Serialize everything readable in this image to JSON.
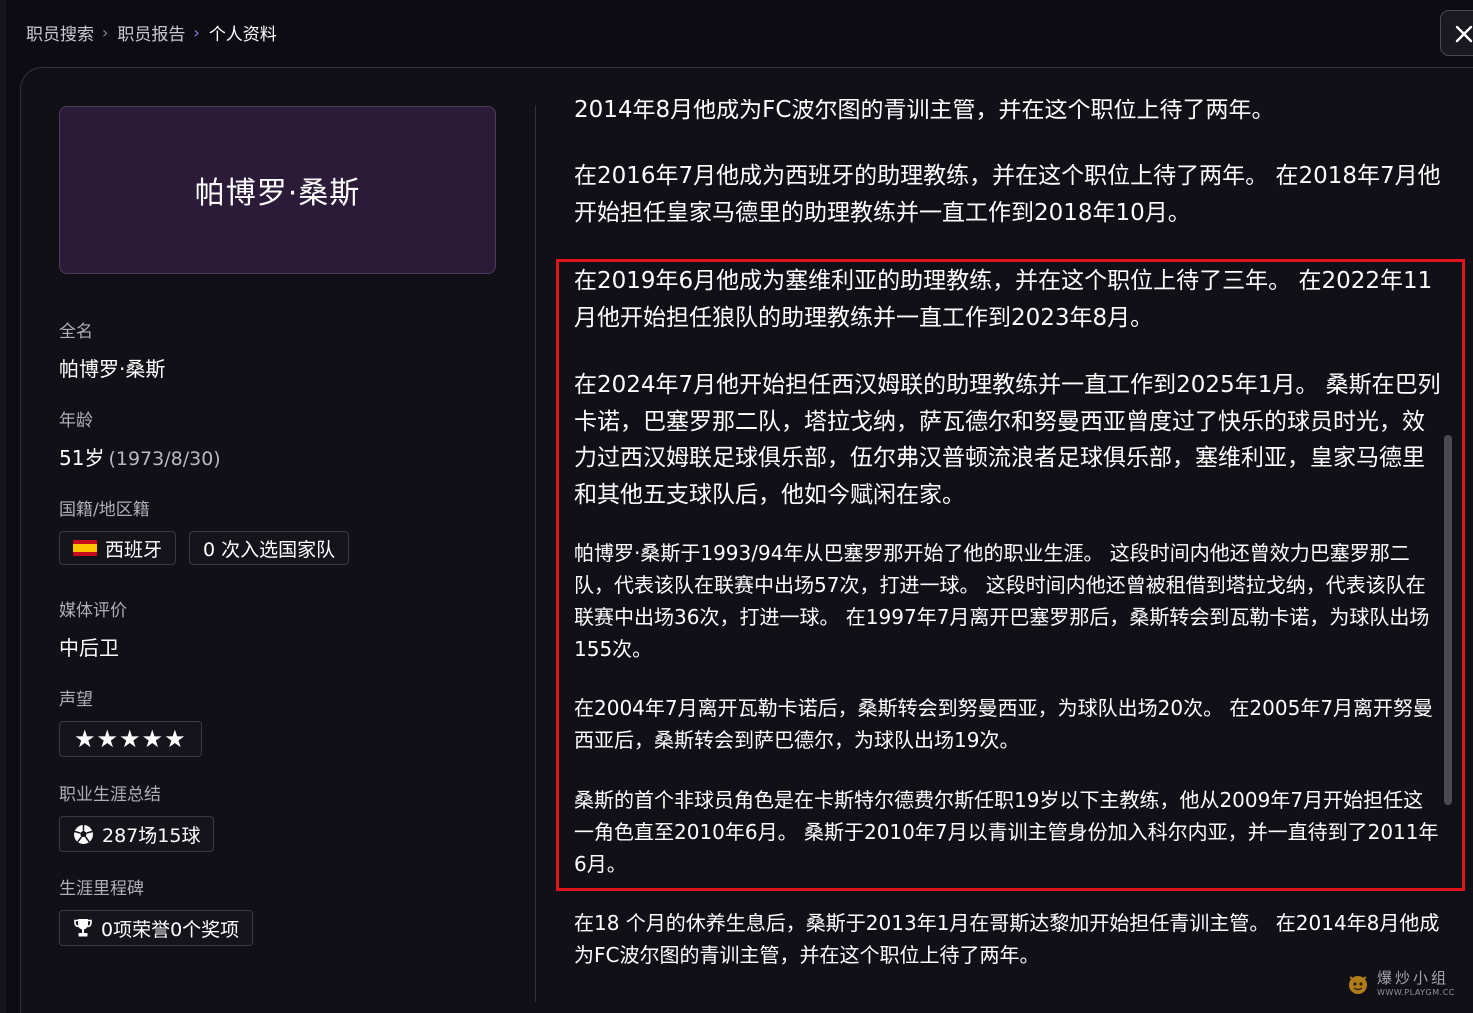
{
  "breadcrumb": {
    "items": [
      "职员搜索",
      "职员报告",
      "个人资料"
    ]
  },
  "close_button": {
    "icon": "close-icon"
  },
  "profile": {
    "card_name": "帕博罗·桑斯",
    "fields": {
      "full_name": {
        "label": "全名",
        "value": "帕博罗·桑斯"
      },
      "age": {
        "label": "年龄",
        "value": "51岁",
        "birth": "(1973/8/30)"
      },
      "nationality": {
        "label": "国籍/地区籍",
        "country": "西班牙",
        "caps": "0 次入选国家队"
      },
      "media_rating": {
        "label": "媒体评价",
        "value": "中后卫"
      },
      "reputation": {
        "label": "声望",
        "stars": 5,
        "stars_display": "★★★★★"
      },
      "career_summary": {
        "label": "职业生涯总结",
        "value": "287场15球"
      },
      "milestones": {
        "label": "生涯里程碑",
        "value": "0项荣誉0个奖项"
      }
    }
  },
  "bio": {
    "cut_paragraph": "2014年8月他成为FC波尔图的青训主管，并在这个职位上待了两年。",
    "paragraphs": [
      "在2016年7月他成为西班牙的助理教练，并在这个职位上待了两年。 在2018年7月他开始担任皇家马德里的助理教练并一直工作到2018年10月。",
      "在2019年6月他成为塞维利亚的助理教练，并在这个职位上待了三年。 在2022年11月他开始担任狼队的助理教练并一直工作到2023年8月。",
      "在2024年7月他开始担任西汉姆联的助理教练并一直工作到2025年1月。 桑斯在巴列卡诺，巴塞罗那二队，塔拉戈纳，萨瓦德尔和努曼西亚曾度过了快乐的球员时光，效力过西汉姆联足球俱乐部，伍尔弗汉普顿流浪者足球俱乐部，塞维利亚，皇家马德里和其他五支球队后，他如今赋闲在家。",
      "帕博罗·桑斯于1993/94年从巴塞罗那开始了他的职业生涯。 这段时间内他还曾效力巴塞罗那二队，代表该队在联赛中出场57次，打进一球。 这段时间内他还曾被租借到塔拉戈纳，代表该队在联赛中出场36次，打进一球。 在1997年7月离开巴塞罗那后，桑斯转会到瓦勒卡诺，为球队出场155次。",
      "在2004年7月离开瓦勒卡诺后，桑斯转会到努曼西亚，为球队出场20次。 在2005年7月离开努曼西亚后，桑斯转会到萨巴德尔，为球队出场19次。",
      "桑斯的首个非球员角色是在卡斯特尔德费尔斯任职19岁以下主教练，他从2009年7月开始担任这一角色直至2010年6月。 桑斯于2010年7月以青训主管身份加入科尔内亚，并一直待到了2011年6月。",
      "在18 个月的休养生息后，桑斯于2013年1月在哥斯达黎加开始担任青训主管。 在2014年8月他成为FC波尔图的青训主管，并在这个职位上待了两年。"
    ]
  },
  "watermark": {
    "text_cn": "爆炒小组",
    "text_en": "WWW.PLAYGM.CC"
  },
  "colors": {
    "background": "#0d0c12",
    "name_card": "#2b1b39",
    "highlight": "#e0141e",
    "accent": "#8b7ff0"
  }
}
